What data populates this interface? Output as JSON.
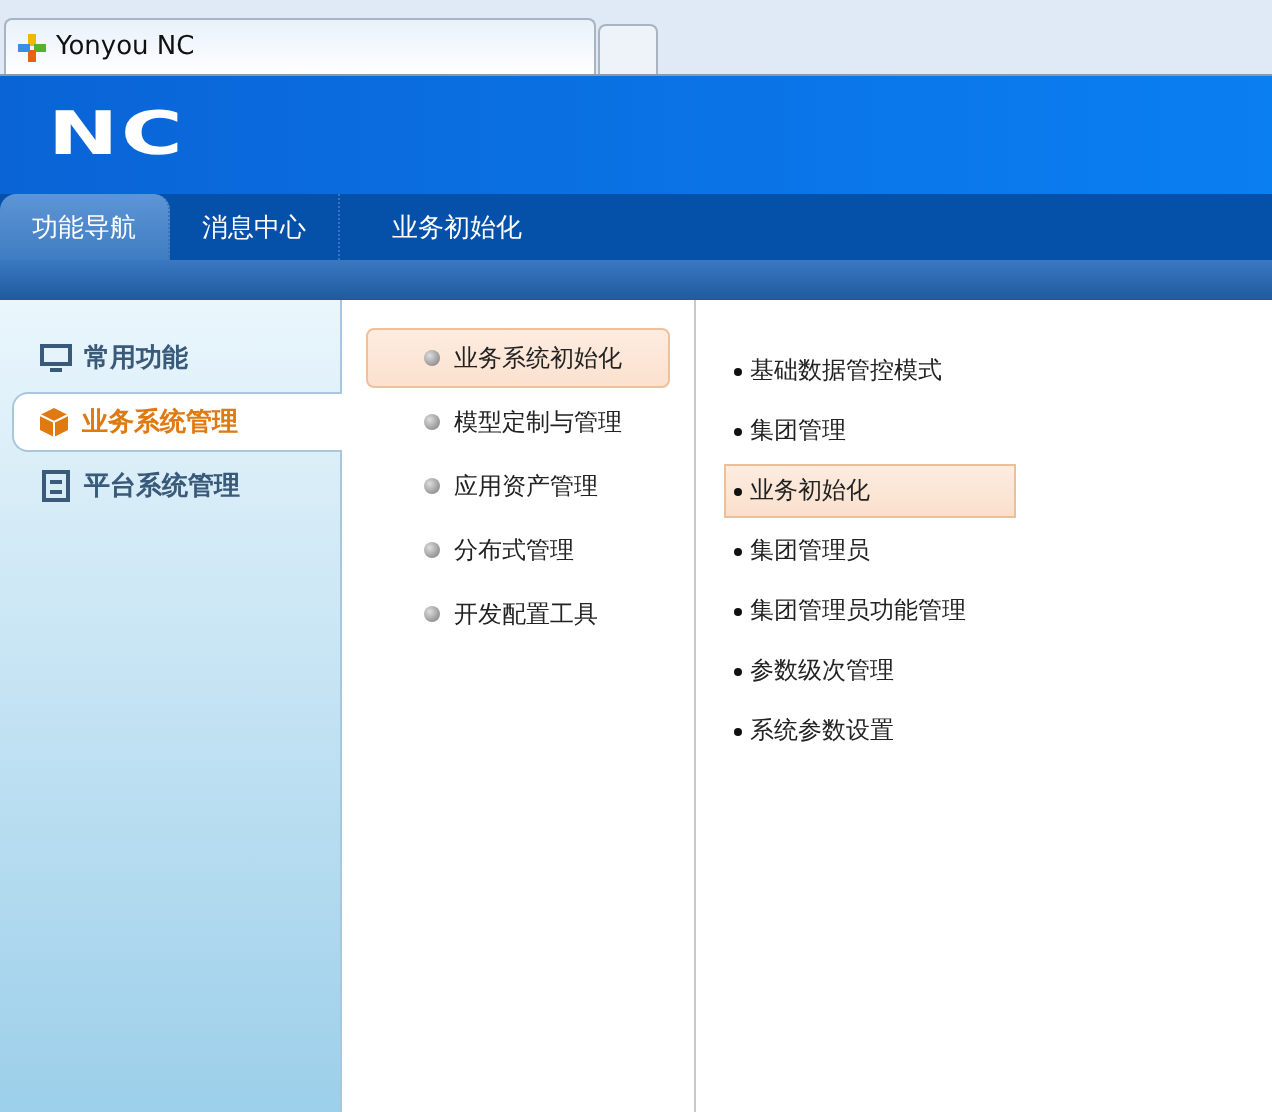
{
  "browser_tab": {
    "title": "Yonyou NC"
  },
  "header": {
    "logo": "NC"
  },
  "tabs": [
    {
      "label": "功能导航",
      "selected": true
    },
    {
      "label": "消息中心",
      "selected": false
    },
    {
      "label": "业务初始化",
      "selected": false
    }
  ],
  "sidebar": {
    "items": [
      {
        "label": "常用功能",
        "selected": false
      },
      {
        "label": "业务系统管理",
        "selected": true
      },
      {
        "label": "平台系统管理",
        "selected": false
      }
    ]
  },
  "modules": [
    {
      "label": "业务系统初始化",
      "selected": true
    },
    {
      "label": "模型定制与管理",
      "selected": false
    },
    {
      "label": "应用资产管理",
      "selected": false
    },
    {
      "label": "分布式管理",
      "selected": false
    },
    {
      "label": "开发配置工具",
      "selected": false
    }
  ],
  "functions": [
    {
      "label": "基础数据管控模式",
      "selected": false
    },
    {
      "label": "集团管理",
      "selected": false
    },
    {
      "label": "业务初始化",
      "selected": true
    },
    {
      "label": "集团管理员",
      "selected": false
    },
    {
      "label": "集团管理员功能管理",
      "selected": false
    },
    {
      "label": "参数级次管理",
      "selected": false
    },
    {
      "label": "系统参数设置",
      "selected": false
    }
  ]
}
